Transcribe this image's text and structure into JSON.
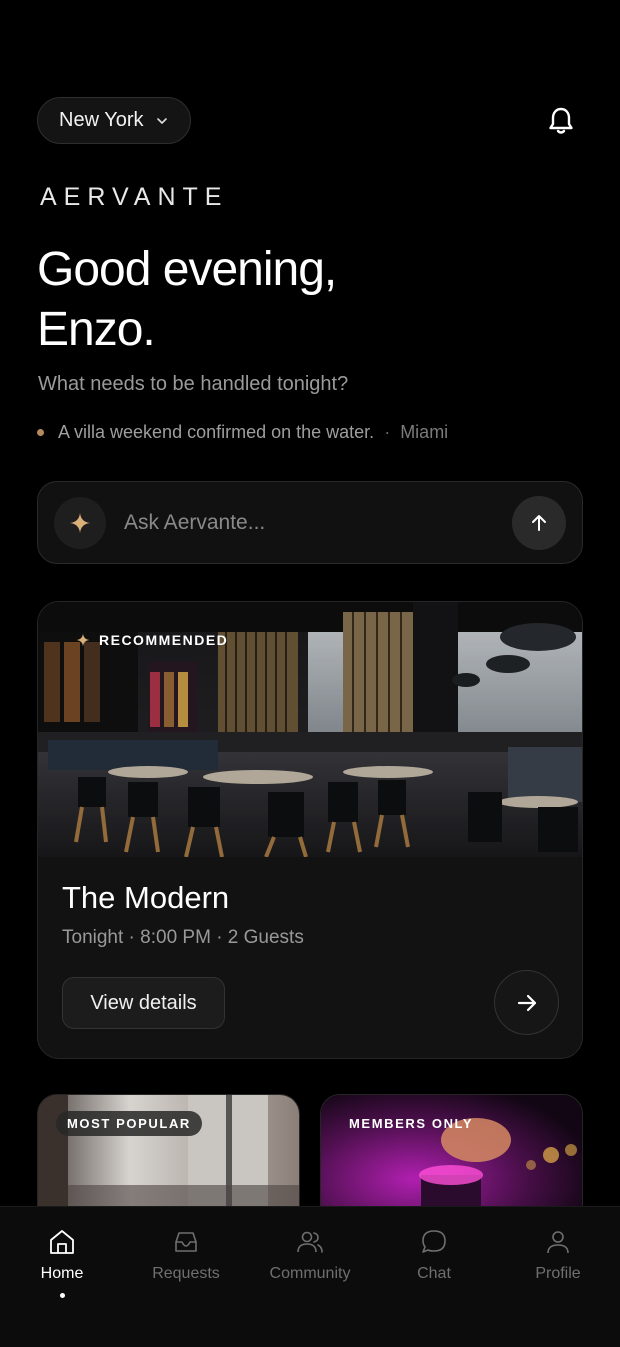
{
  "header": {
    "city": "New York",
    "brand": "AERVANTE"
  },
  "greeting": {
    "line1": "Good evening,",
    "line2": "Enzo.",
    "prompt": "What needs to be handled tonight?"
  },
  "ticker": {
    "message": "A villa weekend confirmed on the water.",
    "separator": "·",
    "location": "Miami",
    "dot_color": "#b58a5e"
  },
  "ask": {
    "placeholder": "Ask Aervante..."
  },
  "recommended": {
    "badge": "RECOMMENDED",
    "title": "The Modern",
    "meta": "Tonight · 8:00 PM · 2 Guests",
    "button": "View details"
  },
  "mini_cards": [
    {
      "badge": "MOST POPULAR"
    },
    {
      "badge": "MEMBERS ONLY"
    }
  ],
  "tabs": [
    {
      "label": "Home",
      "icon": "home-icon",
      "active": true
    },
    {
      "label": "Requests",
      "icon": "inbox-icon",
      "active": false
    },
    {
      "label": "Community",
      "icon": "users-icon",
      "active": false
    },
    {
      "label": "Chat",
      "icon": "chat-bubble-icon",
      "active": false
    },
    {
      "label": "Profile",
      "icon": "user-icon",
      "active": false
    }
  ],
  "colors": {
    "background": "#000000",
    "accent_gold": "#d9b07a",
    "surface": "#121212"
  }
}
